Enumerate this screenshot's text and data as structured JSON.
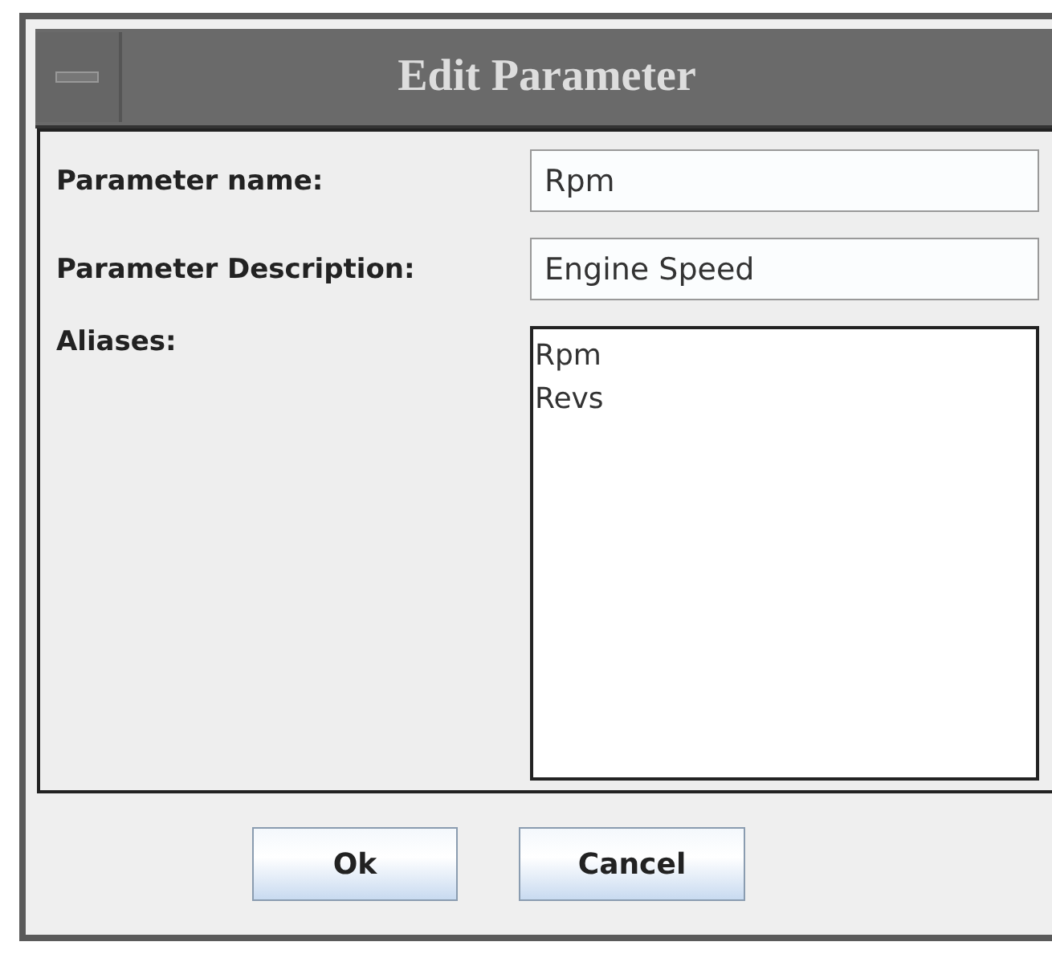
{
  "window": {
    "title": "Edit Parameter"
  },
  "fields": [
    {
      "label": "Parameter name:",
      "value": "Rpm"
    },
    {
      "label": "Parameter Description:",
      "value": "Engine Speed"
    }
  ],
  "aliases": {
    "label": "Aliases:",
    "items": [
      "Rpm",
      "Revs"
    ]
  },
  "buttons": [
    "Ok",
    "Cancel"
  ]
}
